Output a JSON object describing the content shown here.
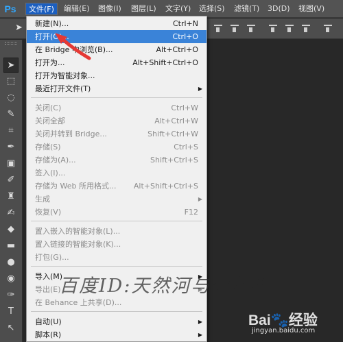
{
  "menubar": {
    "logo": "Ps",
    "items": [
      {
        "label": "文件(F)",
        "active": true
      },
      {
        "label": "编辑(E)"
      },
      {
        "label": "图像(I)"
      },
      {
        "label": "图层(L)"
      },
      {
        "label": "文字(Y)"
      },
      {
        "label": "选择(S)"
      },
      {
        "label": "滤镜(T)"
      },
      {
        "label": "3D(D)"
      },
      {
        "label": "视图(V)"
      }
    ]
  },
  "file_menu": {
    "items": [
      {
        "label": "新建(N)...",
        "shortcut": "Ctrl+N",
        "enabled": true
      },
      {
        "label": "打开(O)...",
        "shortcut": "Ctrl+O",
        "enabled": true,
        "highlighted": true
      },
      {
        "label": "在 Bridge 中浏览(B)...",
        "shortcut": "Alt+Ctrl+O",
        "enabled": true
      },
      {
        "label": "打开为...",
        "shortcut": "Alt+Shift+Ctrl+O",
        "enabled": true
      },
      {
        "label": "打开为智能对象...",
        "shortcut": "",
        "enabled": true
      },
      {
        "label": "最近打开文件(T)",
        "shortcut": "",
        "enabled": true,
        "submenu": true
      },
      {
        "label": "关闭(C)",
        "shortcut": "Ctrl+W",
        "enabled": false
      },
      {
        "label": "关闭全部",
        "shortcut": "Alt+Ctrl+W",
        "enabled": false
      },
      {
        "label": "关闭并转到 Bridge...",
        "shortcut": "Shift+Ctrl+W",
        "enabled": false
      },
      {
        "label": "存储(S)",
        "shortcut": "Ctrl+S",
        "enabled": false
      },
      {
        "label": "存储为(A)...",
        "shortcut": "Shift+Ctrl+S",
        "enabled": false
      },
      {
        "label": "签入(I)...",
        "shortcut": "",
        "enabled": false
      },
      {
        "label": "存储为 Web 所用格式...",
        "shortcut": "Alt+Shift+Ctrl+S",
        "enabled": false
      },
      {
        "label": "生成",
        "shortcut": "",
        "enabled": false,
        "submenu": true
      },
      {
        "label": "恢复(V)",
        "shortcut": "F12",
        "enabled": false
      },
      {
        "label": "置入嵌入的智能对象(L)...",
        "shortcut": "",
        "enabled": false
      },
      {
        "label": "置入链接的智能对象(K)...",
        "shortcut": "",
        "enabled": false
      },
      {
        "label": "打包(G)...",
        "shortcut": "",
        "enabled": false
      },
      {
        "label": "导入(M)",
        "shortcut": "",
        "enabled": true,
        "submenu": true
      },
      {
        "label": "导出(E)",
        "shortcut": "",
        "enabled": false,
        "submenu": true
      },
      {
        "label": "在 Behance 上共享(D)...",
        "shortcut": "",
        "enabled": false
      },
      {
        "label": "自动(U)",
        "shortcut": "",
        "enabled": true,
        "submenu": true
      },
      {
        "label": "脚本(R)",
        "shortcut": "",
        "enabled": true,
        "submenu": true
      }
    ]
  },
  "tools": [
    {
      "icon": "move-tool-icon",
      "glyph": "➤"
    },
    {
      "icon": "marquee-tool-icon",
      "glyph": "⬚"
    },
    {
      "icon": "lasso-tool-icon",
      "glyph": "◌"
    },
    {
      "icon": "quick-selection-tool-icon",
      "glyph": "✎"
    },
    {
      "icon": "crop-tool-icon",
      "glyph": "⌗"
    },
    {
      "icon": "eyedropper-tool-icon",
      "glyph": "✒"
    },
    {
      "icon": "healing-brush-tool-icon",
      "glyph": "▣"
    },
    {
      "icon": "brush-tool-icon",
      "glyph": "✐"
    },
    {
      "icon": "stamp-tool-icon",
      "glyph": "♜"
    },
    {
      "icon": "history-brush-tool-icon",
      "glyph": "✍"
    },
    {
      "icon": "eraser-tool-icon",
      "glyph": "◆"
    },
    {
      "icon": "gradient-tool-icon",
      "glyph": "▬"
    },
    {
      "icon": "blur-tool-icon",
      "glyph": "●"
    },
    {
      "icon": "dodge-tool-icon",
      "glyph": "◉"
    },
    {
      "icon": "pen-tool-icon",
      "glyph": "✑"
    },
    {
      "icon": "type-tool-icon",
      "glyph": "T"
    },
    {
      "icon": "path-selection-tool-icon",
      "glyph": "↖"
    },
    {
      "icon": "shape-tool-icon",
      "glyph": "▭"
    }
  ],
  "watermark": {
    "text": "百度ID:天然河与你相约",
    "baidu_logo": "Bai🐾经验",
    "baidu_url": "jingyan.baidu.com"
  },
  "colors": {
    "menu_highlight": "#3a83d8",
    "annotation_arrow": "#e53935"
  }
}
